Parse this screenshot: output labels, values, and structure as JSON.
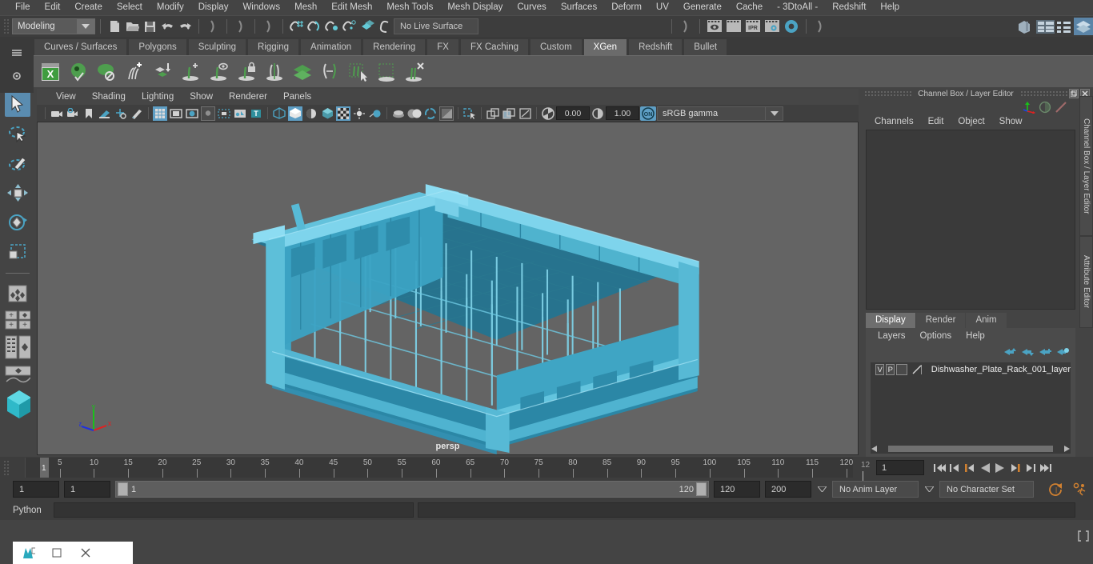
{
  "menubar": [
    "File",
    "Edit",
    "Create",
    "Select",
    "Modify",
    "Display",
    "Windows",
    "Mesh",
    "Edit Mesh",
    "Mesh Tools",
    "Mesh Display",
    "Curves",
    "Surfaces",
    "Deform",
    "UV",
    "Generate",
    "Cache",
    "- 3DtoAll -",
    "Redshift",
    "Help"
  ],
  "statusline": {
    "menuset": "Modeling",
    "live_surface": "No Live Surface",
    "ipr_label": "IPR",
    "icons": [
      "new-scene-icon",
      "open-scene-icon",
      "save-scene-icon",
      "undo-icon",
      "redo-icon",
      "select-by-hierarchy-icon",
      "select-by-object-icon",
      "select-by-component-icon",
      "snap-to-grid-icon",
      "snap-to-curve-icon",
      "snap-to-point-icon",
      "snap-to-projected-center-icon",
      "snap-to-view-plane-icon",
      "make-live-icon",
      "render-current-frame-icon",
      "render-sequence-icon",
      "ipr-render-icon",
      "render-settings-icon",
      "hypershade-icon",
      "show-editors-icon",
      "outliner-icon",
      "attribute-editor-icon"
    ]
  },
  "shelf": {
    "tabs": [
      "Curves / Surfaces",
      "Polygons",
      "Sculpting",
      "Rigging",
      "Animation",
      "Rendering",
      "FX",
      "FX Caching",
      "Custom",
      "XGen",
      "Redshift",
      "Bullet"
    ],
    "active_tab": "XGen",
    "icons": [
      "xgen-editor-icon",
      "xgen-preview-icon",
      "xgen-disable-preview-icon",
      "xgen-add-description-icon",
      "xgen-import-collection-icon",
      "xgen-add-grooming-icon",
      "xgen-display-icon",
      "xgen-lock-icon",
      "xgen-mirror-icon",
      "xgen-layers-icon",
      "xgen-convert-icon",
      "xgen-select-guides-icon",
      "xgen-region-icon",
      "xgen-delete-icon"
    ]
  },
  "toolbox": {
    "tools": [
      "select-tool",
      "lasso-select-tool",
      "paint-select-tool",
      "move-tool",
      "rotate-tool",
      "scale-tool",
      "last-tool-used",
      "quick-layout-single",
      "quick-layout-four",
      "quick-layout-outliner-persp",
      "quick-layout-persp-graph",
      "quick-layout-hypershade"
    ],
    "selected": "select-tool"
  },
  "viewport": {
    "menus": [
      "View",
      "Shading",
      "Lighting",
      "Show",
      "Renderer",
      "Panels"
    ],
    "exposure": "0.00",
    "gamma": "1.00",
    "color_management": "sRGB gamma",
    "camera_label": "persp",
    "axis": {
      "x": "x",
      "y": "y",
      "z": "z"
    },
    "toolbar_icons": [
      "select-camera-icon",
      "camera-attributes-icon",
      "bookmarks-icon",
      "image-plane-icon",
      "2d-pan-zoom-icon",
      "grease-pencil-icon",
      "grid-toggle-icon",
      "film-gate-icon",
      "resolution-gate-icon",
      "gate-mask-icon",
      "film-origin-icon",
      "safe-action-icon",
      "xray-joints-icon",
      "wireframe-icon",
      "smooth-shade-icon",
      "shade-all-icon",
      "textured-icon",
      "use-default-lighting-icon",
      "shadows-icon",
      "ambient-occlusion-icon",
      "motion-blur-icon",
      "anti-alias-icon",
      "isolate-select-icon",
      "xray-icon",
      "xray-active-icon",
      "xray-components-icon",
      "exposure-icon",
      "gamma-icon",
      "color-mgmt-toggle-icon"
    ],
    "colormgmt_state": "ON"
  },
  "rightpanel": {
    "title": "Channel Box / Layer Editor",
    "menus": [
      "Channels",
      "Edit",
      "Object",
      "Show"
    ],
    "header_icons": [
      "channel-box-icon",
      "attribute-editor-icon",
      "modeling-toolkit-icon"
    ],
    "side_tabs": [
      "Channel Box / Layer Editor",
      "Attribute Editor"
    ],
    "layer_editor": {
      "tabs": [
        "Display",
        "Render",
        "Anim"
      ],
      "active_tab": "Display",
      "menus": [
        "Layers",
        "Options",
        "Help"
      ],
      "icon_buttons": [
        "move-layer-up-icon",
        "move-layer-down-icon",
        "new-layer-icon",
        "new-layer-from-selected-icon"
      ],
      "layers": [
        {
          "visibility": "V",
          "playback": "P",
          "color": "",
          "name": "Dishwasher_Plate_Rack_001_layer"
        }
      ]
    }
  },
  "timeline": {
    "ticks": [
      5,
      10,
      15,
      20,
      25,
      30,
      35,
      40,
      45,
      50,
      55,
      60,
      65,
      70,
      75,
      80,
      85,
      90,
      95,
      100,
      105,
      110,
      115,
      120
    ],
    "current_frame_marker": "1",
    "end_label": "12",
    "current_frame_field": "1",
    "playback_buttons": [
      "go-to-start-icon",
      "step-back-keyframe-icon",
      "step-back-frame-icon",
      "play-backwards-icon",
      "play-forwards-icon",
      "step-forward-frame-icon",
      "step-forward-keyframe-icon",
      "go-to-end-icon"
    ]
  },
  "range": {
    "anim_start": "1",
    "range_start": "1",
    "slider_min": "1",
    "slider_max": "120",
    "range_end": "120",
    "anim_end": "200",
    "anim_layer": "No Anim Layer",
    "character_set": "No Character Set",
    "right_icons": [
      "auto-key-icon",
      "animation-preferences-icon"
    ]
  },
  "command": {
    "language_label": "Python",
    "input_value": "",
    "result_value": ""
  },
  "taskbar": {
    "items": [
      "maya-app-icon",
      "restore-window-icon",
      "close-window-icon"
    ]
  },
  "colors": {
    "accent_teal": "#4ba3c3",
    "model_cyan": "#3ea9c8",
    "highlight_blue": "#5e9ec4",
    "orange": "#d4803a",
    "xgen_green": "#4a9e4a"
  }
}
